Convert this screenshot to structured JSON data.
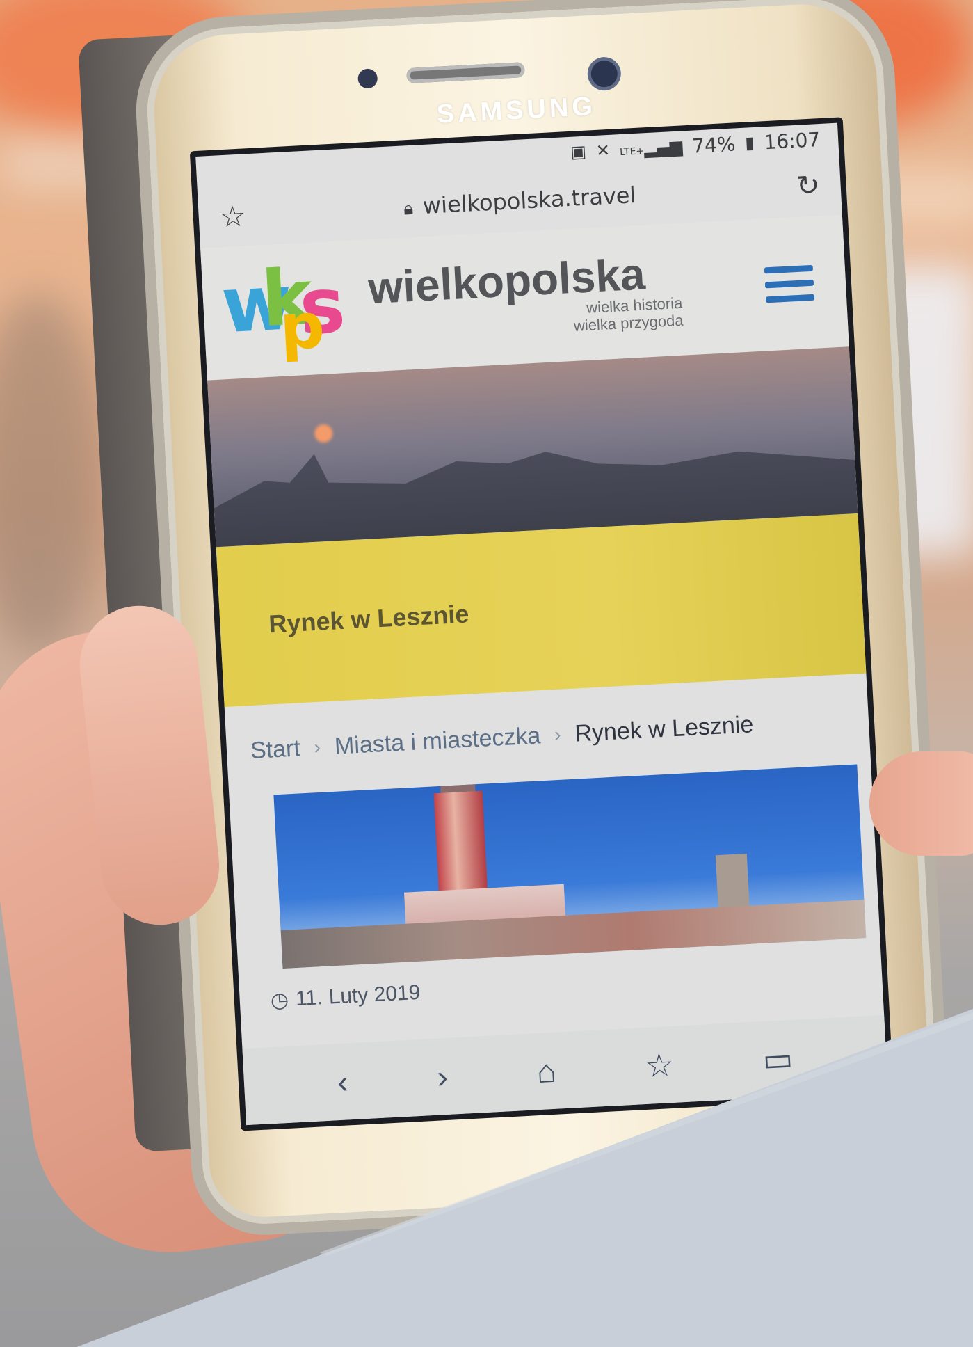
{
  "phone": {
    "brand": "SAMSUNG"
  },
  "statusbar": {
    "icons": [
      "sd-card-icon",
      "mute-icon",
      "lte-signal-icon",
      "battery-icon"
    ],
    "lte": "LTE+",
    "battery": "74%",
    "time": "16:07"
  },
  "browser": {
    "url": "wielkopolska.travel",
    "star_icon": "star-icon",
    "lock_icon": "lock-icon",
    "reload_icon": "reload-icon"
  },
  "site": {
    "logo_letters": [
      "w",
      "k",
      "s",
      "p"
    ],
    "name": "wielkopolska",
    "tagline_1": "wielka historia",
    "tagline_2": "wielka przygoda",
    "colors": {
      "blue": "#3aa4d8",
      "green": "#7bc043",
      "pink": "#e8498f",
      "yellow": "#f5b800",
      "menu": "#2d6fb6"
    }
  },
  "page": {
    "title": "Rynek w Lesznie",
    "banner_color": "#e2cd4c",
    "breadcrumb": [
      "Start",
      "Miasta i miasteczka",
      "Rynek w Lesznie"
    ],
    "breadcrumb_sep": "›",
    "date": "11. Luty 2019"
  },
  "navbar": {
    "icons": [
      "back-icon",
      "forward-icon",
      "home-icon",
      "bookmarks-icon",
      "tabs-icon"
    ],
    "glyphs": [
      "‹",
      "›",
      "⌂",
      "☆",
      "▭"
    ]
  }
}
